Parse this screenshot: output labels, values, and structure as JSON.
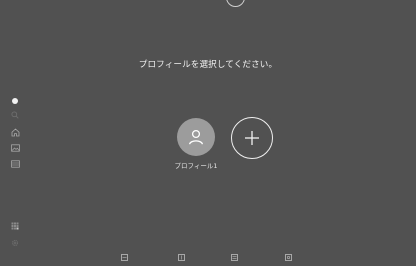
{
  "title": "プロフィールを選択してください。",
  "profiles": [
    {
      "name": "プロフィール1"
    }
  ],
  "add_button_label": "+",
  "sidebar": {
    "items": [
      {
        "icon": "status-dot-icon"
      },
      {
        "icon": "search-icon"
      },
      {
        "icon": "home-icon"
      },
      {
        "icon": "image-icon"
      },
      {
        "icon": "film-icon"
      },
      {
        "icon": "grid-icon"
      },
      {
        "icon": "settings-icon"
      }
    ]
  },
  "bottom_icons": [
    "bottom-icon-1",
    "bottom-icon-2",
    "bottom-icon-3",
    "bottom-icon-4"
  ],
  "colors": {
    "background": "#515151",
    "text": "#f2f2f2",
    "avatar": "#9c9c9c"
  }
}
